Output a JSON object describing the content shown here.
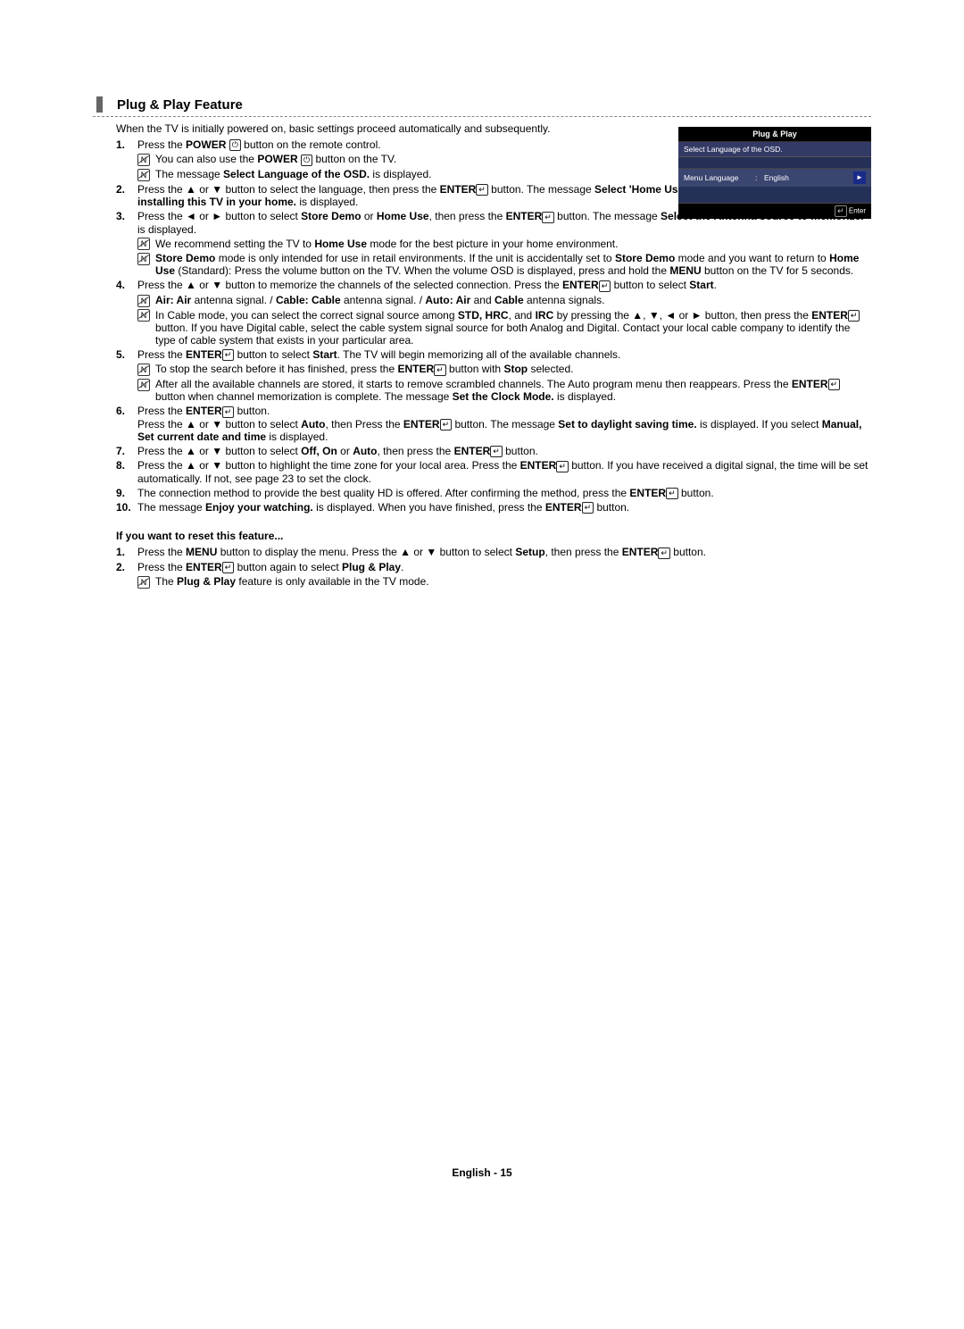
{
  "section_title": "Plug & Play Feature",
  "intro": "When the TV is initially powered on, basic settings proceed automatically and subsequently.",
  "osd": {
    "title": "Plug & Play",
    "subtitle": "Select Language of the OSD.",
    "row_key": "Menu Language",
    "row_sep": ":",
    "row_val": "English",
    "row_arrow": "►",
    "footer_icon_label": "↵ Enter"
  },
  "step1": {
    "num": "1.",
    "text_a": "Press the ",
    "bold_a": "POWER",
    "power_icon": "⏻",
    "text_b": " button on the remote control.",
    "note1_a": "You can also use the ",
    "note1_bold": "POWER",
    "note1_b": " button on the TV.",
    "note2_a": "The message ",
    "note2_bold": "Select Language of the OSD.",
    "note2_b": " is displayed."
  },
  "step2": {
    "num": "2.",
    "text_a": "Press the ▲ or ▼ button to select the language, then press the ",
    "bold_a": "ENTER",
    "enter_icon": "↵",
    "text_b": " button. The message ",
    "bold_b": "Select 'Home Use' when installing this TV in your home.",
    "text_c": " is displayed."
  },
  "step3": {
    "num": "3.",
    "text_a": "Press the ◄ or ► button to select ",
    "bold_a": "Store Demo",
    "text_b": " or ",
    "bold_b": "Home Use",
    "text_c": ", then press the ",
    "bold_c": "ENTER",
    "text_d": " button. The message ",
    "bold_d": "Select the Antenna source to memorize.",
    "text_e": " is displayed.",
    "note1_a": "We recommend setting the TV to ",
    "note1_bold": "Home Use",
    "note1_b": " mode for the best picture in your home environment.",
    "note2_bold_a": "Store Demo",
    "note2_a": " mode is only intended for use in retail environments. If the unit is accidentally set to ",
    "note2_bold_b": "Store Demo",
    "note2_b": " mode and you want to return to ",
    "note2_bold_c": "Home Use",
    "note2_c": " (Standard): Press the volume button on the TV. When the volume OSD is displayed, press and hold the ",
    "note2_bold_d": "MENU",
    "note2_d": " button on the TV for 5 seconds."
  },
  "step4": {
    "num": "4.",
    "text_a": "Press the ▲ or ▼ button to memorize the channels of the selected connection. Press the ",
    "bold_a": "ENTER",
    "text_b": " button to select ",
    "bold_b": "Start",
    "text_c": ".",
    "note1_bold_a": "Air: Air",
    "note1_a": " antenna signal. / ",
    "note1_bold_b": "Cable: Cable",
    "note1_b": " antenna signal. / ",
    "note1_bold_c": "Auto: Air",
    "note1_c": " and ",
    "note1_bold_d": "Cable",
    "note1_d": " antenna signals.",
    "note2_a": "In Cable mode, you can select the correct signal source among ",
    "note2_bold_a": "STD, HRC",
    "note2_b": ", and ",
    "note2_bold_b": "IRC",
    "note2_c": " by pressing the ▲, ▼, ◄ or ► button, then press the ",
    "note2_bold_c": "ENTER",
    "note2_d": " button. If you have Digital cable, select the cable system signal source for both Analog and Digital. Contact your local cable company to identify the type of cable system that exists in your particular area."
  },
  "step5": {
    "num": "5.",
    "text_a": "Press the ",
    "bold_a": "ENTER",
    "text_b": " button to select ",
    "bold_b": "Start",
    "text_c": ". The TV will begin memorizing all of the available channels.",
    "note1_a": "To stop the search before it has finished, press the ",
    "note1_bold_a": "ENTER",
    "note1_b": " button with ",
    "note1_bold_b": "Stop",
    "note1_c": " selected.",
    "note2_a": "After all the available channels are stored, it starts to remove scrambled channels. The Auto program menu then reappears. Press the ",
    "note2_bold_a": "ENTER",
    "note2_b": " button when channel memorization is complete. The message ",
    "note2_bold_b": "Set the Clock Mode.",
    "note2_c": " is displayed."
  },
  "step6": {
    "num": "6.",
    "text_a": "Press the ",
    "bold_a": "ENTER",
    "text_b": " button.",
    "line2_a": "Press the ▲ or ▼ button to select ",
    "line2_bold_a": "Auto",
    "line2_b": ", then Press the ",
    "line2_bold_b": "ENTER",
    "line2_c": " button. The message ",
    "line2_bold_c": "Set to daylight saving time.",
    "line2_d": " is displayed. If you select ",
    "line2_bold_d": "Manual, Set current date and time",
    "line2_e": " is displayed."
  },
  "step7": {
    "num": "7.",
    "text_a": "Press the ▲ or ▼ button to select ",
    "bold_a": "Off, On",
    "text_b": " or ",
    "bold_b": "Auto",
    "text_c": ", then press the ",
    "bold_c": "ENTER",
    "text_d": " button."
  },
  "step8": {
    "num": "8.",
    "text_a": "Press the ▲ or ▼ button to highlight the time zone for your local area. Press the ",
    "bold_a": "ENTER",
    "text_b": " button. If you have received a digital signal, the time will be set automatically. If not, see page 23 to set the clock."
  },
  "step9": {
    "num": "9.",
    "text_a": "The connection method to provide the best quality HD is offered. After confirming the method, press the ",
    "bold_a": "ENTER",
    "text_b": " button."
  },
  "step10": {
    "num": "10.",
    "text_a": "The message ",
    "bold_a": "Enjoy your watching.",
    "text_b": " is displayed. When you have finished, press the ",
    "bold_b": "ENTER",
    "text_c": " button."
  },
  "reset": {
    "heading": "If you want to reset this feature...",
    "s1_num": "1.",
    "s1_a": "Press the ",
    "s1_bold_a": "MENU",
    "s1_b": " button to display the menu. Press the ▲ or ▼ button to select ",
    "s1_bold_b": "Setup",
    "s1_c": ", then press the ",
    "s1_bold_c": "ENTER",
    "s1_d": " button.",
    "s2_num": "2.",
    "s2_a": "Press the ",
    "s2_bold_a": "ENTER",
    "s2_b": " button again to select ",
    "s2_bold_b": "Plug & Play",
    "s2_c": ".",
    "note_a": "The ",
    "note_bold": "Plug & Play",
    "note_b": " feature is only available in the TV mode."
  },
  "footer": "English - 15",
  "note_glyph": "N",
  "enter_glyph": "↵"
}
